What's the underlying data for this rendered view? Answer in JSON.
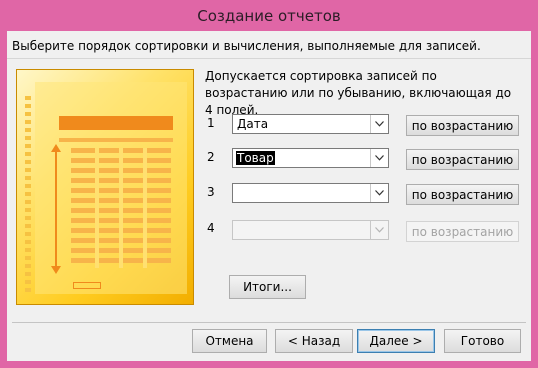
{
  "window": {
    "title": "Создание отчетов"
  },
  "instruction": "Выберите порядок сортировки и вычисления, выполняемые для записей.",
  "info": "Допускается сортировка записей по возрастанию или по убыванию, включающая до 4 полей.",
  "rows": [
    {
      "num": "1",
      "value": "Дата",
      "order": "по возрастанию",
      "enabled": true,
      "selected": false
    },
    {
      "num": "2",
      "value": "Товар",
      "order": "по возрастанию",
      "enabled": true,
      "selected": true
    },
    {
      "num": "3",
      "value": "",
      "order": "по возрастанию",
      "enabled": true,
      "selected": false
    },
    {
      "num": "4",
      "value": "",
      "order": "по возрастанию",
      "enabled": false,
      "selected": false
    }
  ],
  "summary_button": "Итоги...",
  "footer": {
    "cancel": "Отмена",
    "back": "< Назад",
    "next": "Далее >",
    "finish": "Готово"
  },
  "colors": {
    "frame": "#e066a6",
    "client": "#f0f0f0",
    "default_button_border": "#3c7fb1"
  }
}
